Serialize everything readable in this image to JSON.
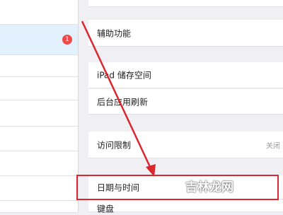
{
  "left_panel": {
    "selected_badge": "1"
  },
  "right_panel": {
    "cells": [
      {
        "label": "",
        "value": ""
      },
      {
        "label": "辅助功能",
        "value": ""
      },
      {
        "label": "iPad 储存空间",
        "value": ""
      },
      {
        "label": "后台应用刷新",
        "value": ""
      },
      {
        "label": "访问限制",
        "value": "关闭"
      },
      {
        "label": "日期与时间",
        "value": ""
      },
      {
        "label": "键盘",
        "value": ""
      }
    ]
  },
  "watermark": {
    "text": "吉林龙网"
  },
  "colors": {
    "highlight": "#d9282f",
    "badge": "#ef4a4a",
    "selected_row": "#e3f0fd"
  }
}
